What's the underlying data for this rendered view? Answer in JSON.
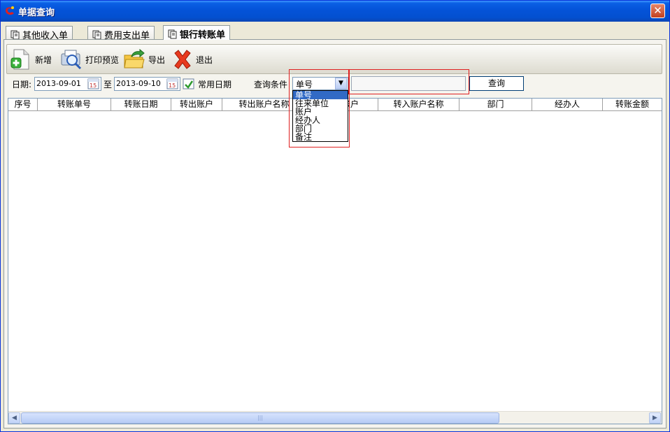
{
  "window": {
    "title": "单据查询",
    "close_label": "✕"
  },
  "tabs": [
    {
      "label": "其他收入单",
      "active": false
    },
    {
      "label": "费用支出单",
      "active": false
    },
    {
      "label": "银行转账单",
      "active": true
    }
  ],
  "toolbar": {
    "new_label": "新增",
    "print_preview_label": "打印预览",
    "export_label": "导出",
    "exit_label": "退出"
  },
  "query": {
    "date_label": "日期:",
    "date_from": "2013-09-01",
    "to_label": "至",
    "date_to": "2013-09-10",
    "common_date_label": "常用日期",
    "condition_label": "查询条件",
    "condition_selected": "单号",
    "condition_options": [
      "单号",
      "往来单位",
      "账户",
      "经办人",
      "部门",
      "备注"
    ],
    "search_value": "",
    "search_button": "查询"
  },
  "grid": {
    "columns": [
      "序号",
      "转账单号",
      "转账日期",
      "转出账户",
      "转出账户名称",
      "转入账户",
      "转入账户名称",
      "部门",
      "经办人",
      "转账金额"
    ],
    "rows": []
  },
  "scrollbar": {
    "grip": "|||"
  },
  "colors": {
    "title_bar": "#0453d8",
    "highlight_box": "#e02020",
    "selection": "#316ac5"
  }
}
